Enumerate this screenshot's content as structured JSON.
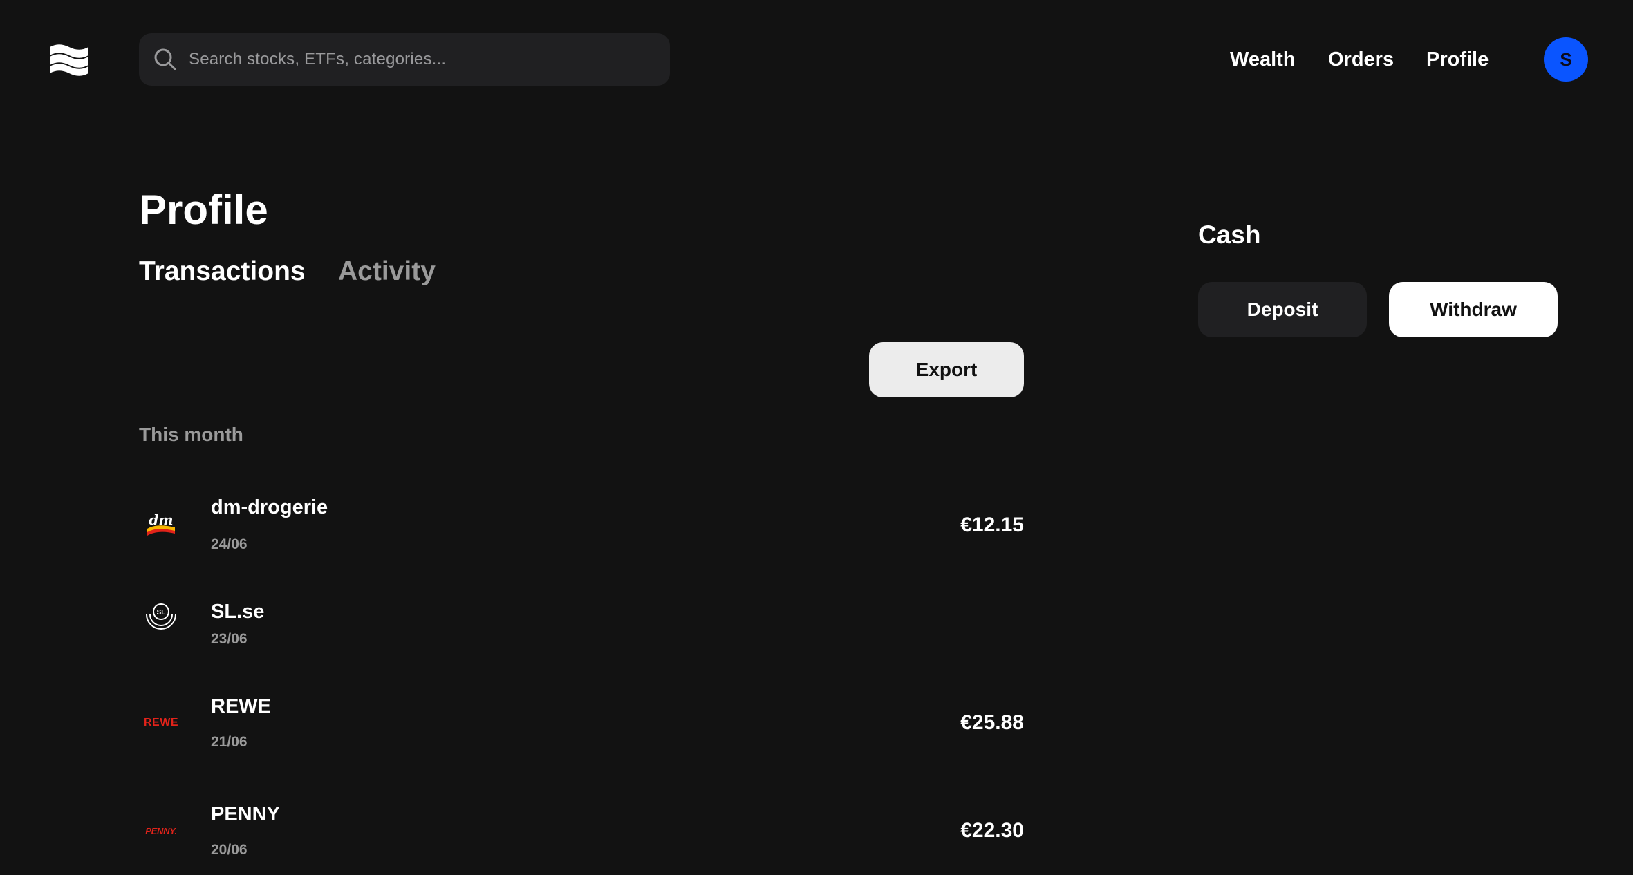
{
  "header": {
    "logo_icon": "wave-flag-icon",
    "search": {
      "icon": "search-icon",
      "placeholder": "Search stocks, ETFs, categories..."
    },
    "nav": [
      {
        "label": "Wealth"
      },
      {
        "label": "Orders"
      },
      {
        "label": "Profile"
      }
    ],
    "avatar_initial": "S",
    "avatar_color": "#0a55ff"
  },
  "main": {
    "title": "Profile",
    "tabs": [
      {
        "label": "Transactions",
        "active": true
      },
      {
        "label": "Activity",
        "active": false
      }
    ],
    "export_label": "Export",
    "section_label": "This month",
    "transactions": [
      {
        "name": "dm-drogerie",
        "date": "24/06",
        "amount": "€12.15",
        "logo_text": "dm",
        "logo_icon": "dm-logo-icon"
      },
      {
        "name": "SL.se",
        "date": "23/06",
        "amount": "",
        "logo_text": "SL",
        "logo_icon": "sl-logo-icon"
      },
      {
        "name": "REWE",
        "date": "21/06",
        "amount": "€25.88",
        "logo_text": "REWE",
        "logo_icon": "rewe-logo-icon"
      },
      {
        "name": "PENNY",
        "date": "20/06",
        "amount": "€22.30",
        "logo_text": "PENNY.",
        "logo_icon": "penny-logo-icon"
      }
    ]
  },
  "cash_panel": {
    "title": "Cash",
    "deposit_label": "Deposit",
    "withdraw_label": "Withdraw"
  },
  "colors": {
    "background": "#121212",
    "surface": "#202022",
    "muted_text": "#9a9a9a",
    "brand_red": "#e2231a"
  }
}
